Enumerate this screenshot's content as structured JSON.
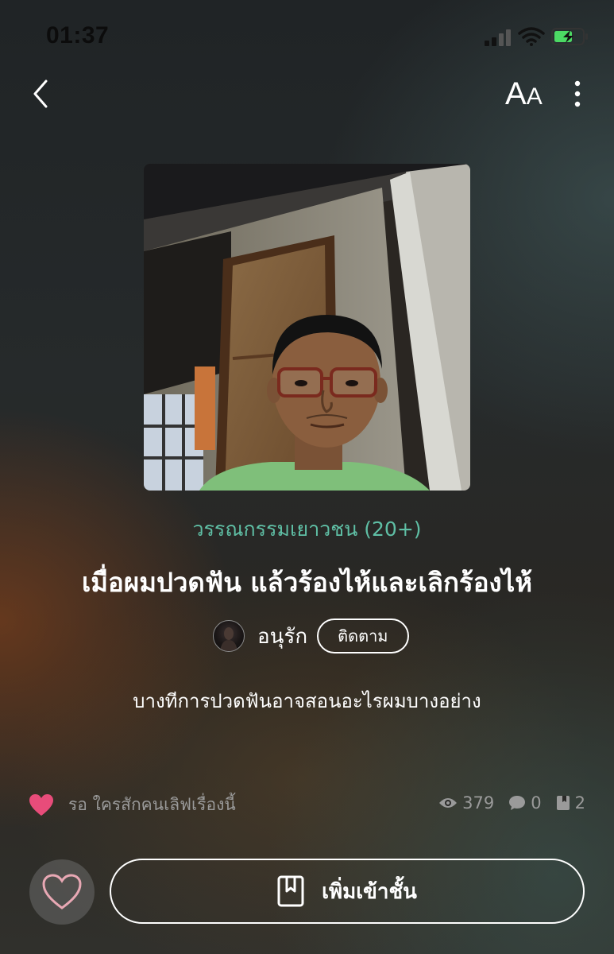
{
  "status_bar": {
    "time": "01:37"
  },
  "nav": {
    "font_size_label_big": "A",
    "font_size_label_small": "A"
  },
  "story": {
    "genre": "วรรณกรรมเยาวชน (20+)",
    "title": "เมื่อผมปวดฟัน แล้วร้องไห้และเลิกร้องไห้",
    "author": "อนุรัก",
    "follow_label": "ติดตาม",
    "synopsis": "บางทีการปวดฟันอาจสอนอะไรผมบางอย่าง"
  },
  "stats": {
    "like_prompt": "รอ ใครสักคนเลิฟเรื่องนี้",
    "views": "379",
    "comments": "0",
    "chapters": "2"
  },
  "actions": {
    "add_library_label": "เพิ่มเข้าชั้น"
  },
  "colors": {
    "genre": "#5fbfa5",
    "heart": "#e84c7a",
    "muted": "#9a9a9a",
    "battery": "#4cd964"
  }
}
